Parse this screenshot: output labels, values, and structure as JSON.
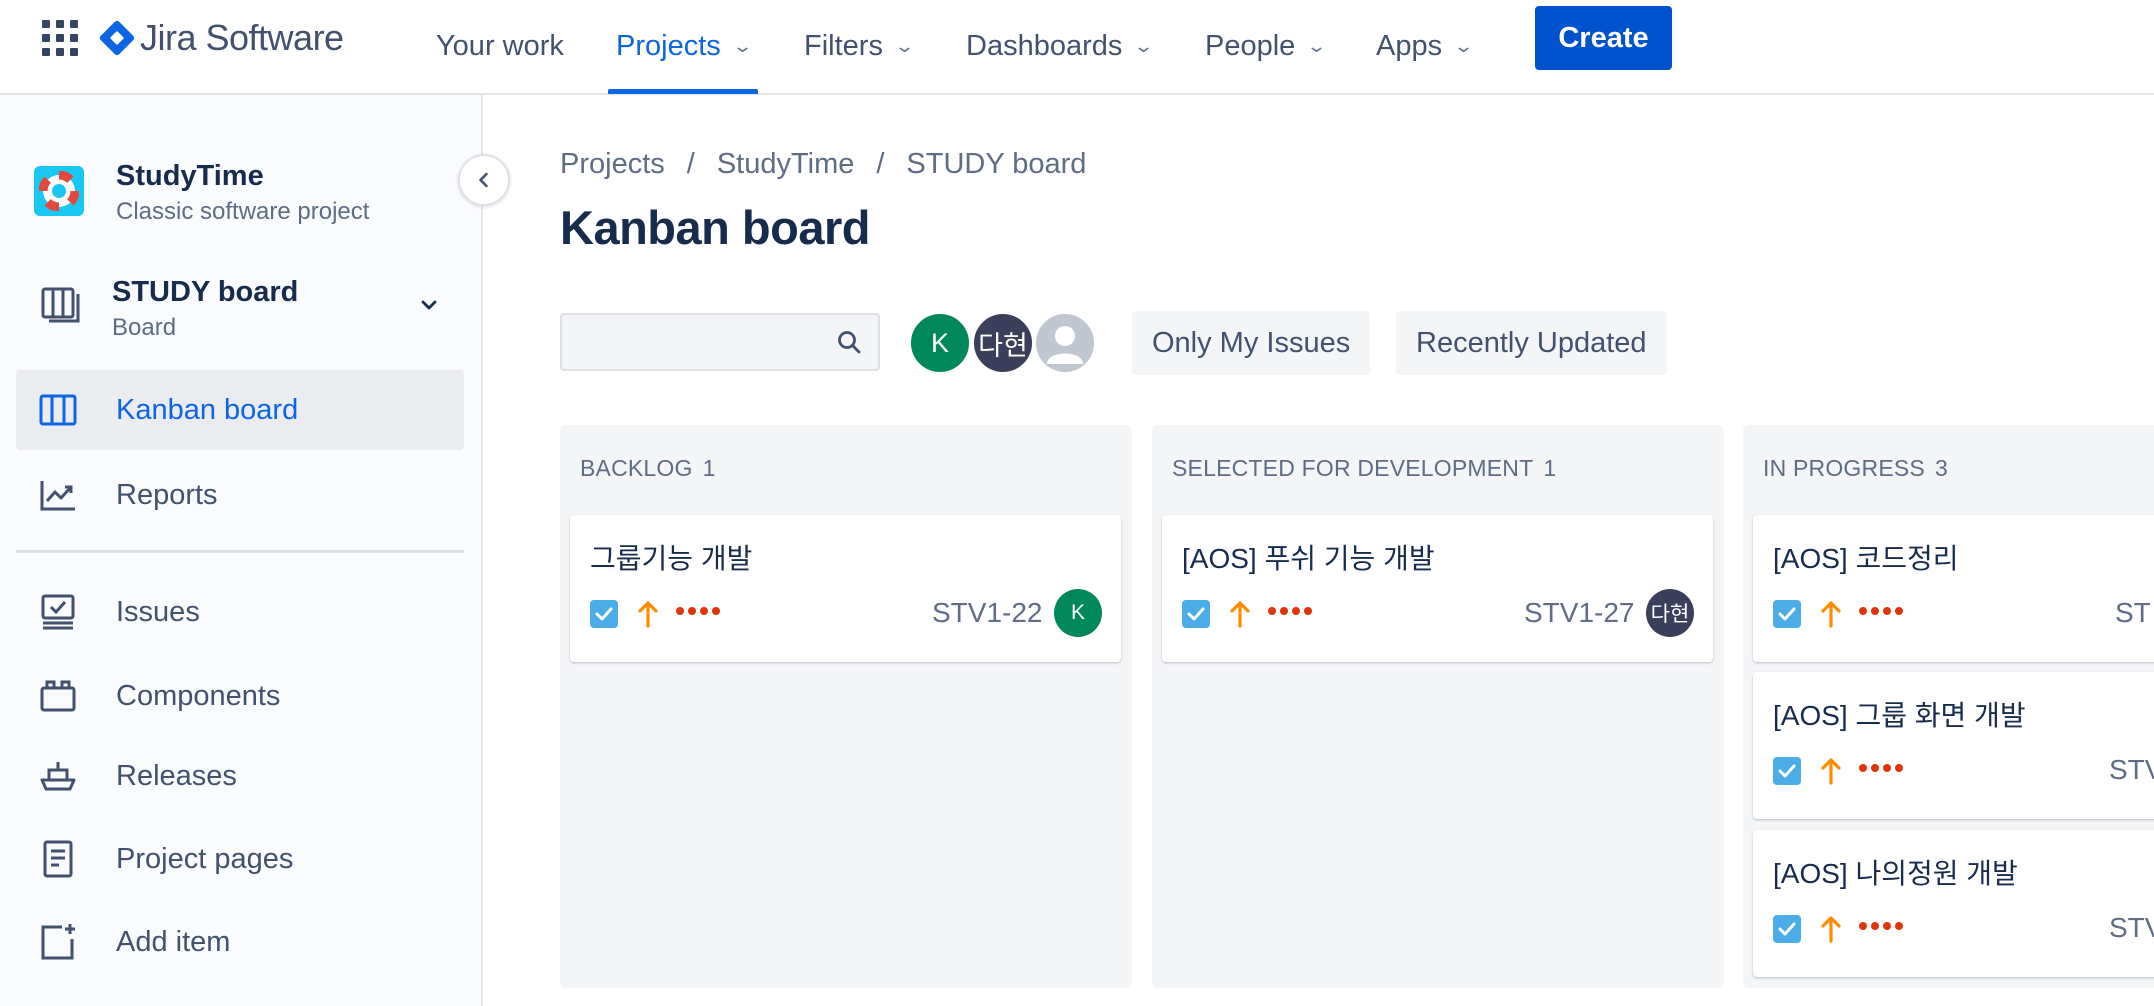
{
  "app": {
    "product_name": "Jira Software"
  },
  "topnav": {
    "items": [
      {
        "label": "Your work",
        "has_menu": false
      },
      {
        "label": "Projects",
        "has_menu": true,
        "active": true
      },
      {
        "label": "Filters",
        "has_menu": true
      },
      {
        "label": "Dashboards",
        "has_menu": true
      },
      {
        "label": "People",
        "has_menu": true
      },
      {
        "label": "Apps",
        "has_menu": true
      }
    ],
    "create_label": "Create"
  },
  "sidebar": {
    "project": {
      "name": "StudyTime",
      "type": "Classic software project"
    },
    "board": {
      "name": "STUDY board",
      "type": "Board"
    },
    "items": [
      {
        "label": "Kanban board",
        "icon": "board-columns-icon",
        "active": true
      },
      {
        "label": "Reports",
        "icon": "reports-chart-icon"
      },
      {
        "label": "Issues",
        "icon": "issues-icon"
      },
      {
        "label": "Components",
        "icon": "components-icon"
      },
      {
        "label": "Releases",
        "icon": "releases-ship-icon"
      },
      {
        "label": "Project pages",
        "icon": "project-pages-icon"
      },
      {
        "label": "Add item",
        "icon": "add-item-icon"
      }
    ]
  },
  "main": {
    "breadcrumb": [
      "Projects",
      "StudyTime",
      "STUDY board"
    ],
    "breadcrumb_separator": "/",
    "title": "Kanban board",
    "search": {
      "value": "",
      "placeholder": ""
    },
    "avatars": [
      {
        "initials": "K",
        "color": "#00875a"
      },
      {
        "initials": "다현",
        "color": "#3b3f5c"
      },
      {
        "initials": "",
        "color": "#c1c7d0",
        "kind": "unassigned"
      }
    ],
    "quick_filters": [
      "Only My Issues",
      "Recently Updated"
    ],
    "columns": [
      {
        "name": "BACKLOG",
        "count": "1",
        "cards": [
          {
            "summary": "그룹기능 개발",
            "key": "STV1-22",
            "assignee": "K",
            "assignee_color": "#00875a"
          }
        ]
      },
      {
        "name": "SELECTED FOR DEVELOPMENT",
        "count": "1",
        "cards": [
          {
            "summary": "[AOS] 푸쉬 기능 개발",
            "key": "STV1-27",
            "assignee": "다현",
            "assignee_color": "#3b3f5c"
          }
        ]
      },
      {
        "name": "IN PROGRESS",
        "count": "3",
        "cards": [
          {
            "summary": "[AOS] 코드정리",
            "key": "ST"
          },
          {
            "summary": "[AOS] 그룹 화면 개발",
            "key": "STV"
          },
          {
            "summary": "[AOS] 나의정원 개발",
            "key": "STV"
          }
        ]
      }
    ]
  },
  "colors": {
    "brand_blue": "#0c66e4",
    "create_button": "#0052cc",
    "priority_high": "#ff8b00",
    "story_points_dots": "#de350b",
    "task_checkbox": "#4bade8"
  }
}
